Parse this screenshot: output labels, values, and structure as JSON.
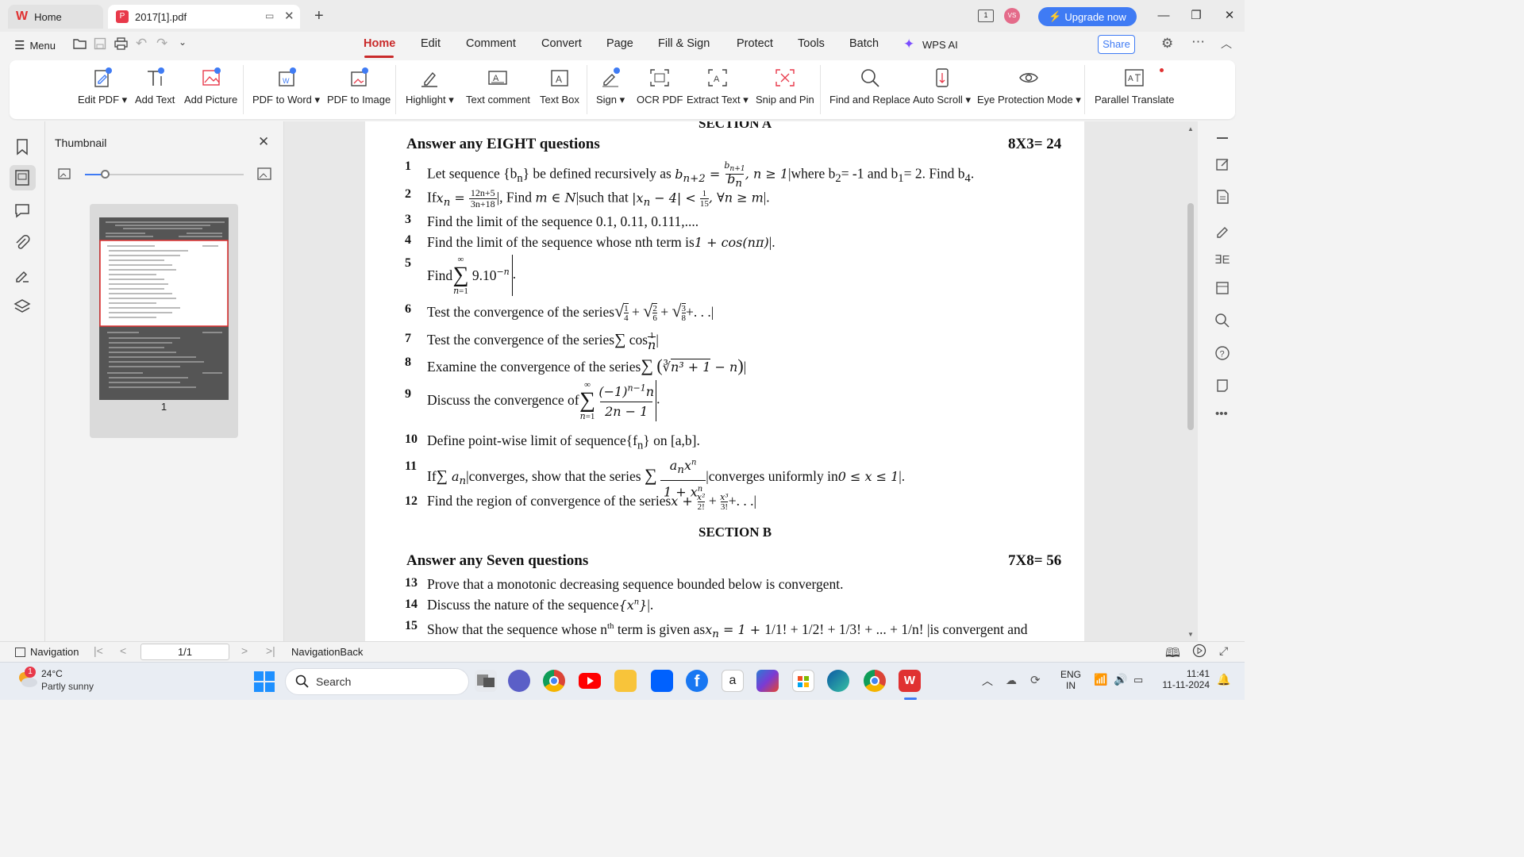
{
  "titlebar": {
    "tabs": [
      {
        "label": "Home"
      },
      {
        "label": "2017[1].pdf"
      }
    ],
    "upgrade_label": "Upgrade now",
    "avatar_initials": "VS",
    "page_count_badge": "1"
  },
  "menubar": {
    "menu_label": "Menu",
    "tabs": [
      "Home",
      "Edit",
      "Comment",
      "Convert",
      "Page",
      "Fill & Sign",
      "Protect",
      "Tools",
      "Batch",
      "WPS AI"
    ],
    "active_tab": "Home",
    "share_label": "Share"
  },
  "ribbon": {
    "items": [
      {
        "label": "Edit PDF",
        "icon": "edit-pdf-icon"
      },
      {
        "label": "Add Text",
        "icon": "add-text-icon"
      },
      {
        "label": "Add Picture",
        "icon": "add-picture-icon"
      },
      {
        "label": "PDF to Word",
        "icon": "pdf-to-word-icon"
      },
      {
        "label": "PDF to Image",
        "icon": "pdf-to-image-icon"
      },
      {
        "label": "Highlight",
        "icon": "highlight-icon"
      },
      {
        "label": "Text comment",
        "icon": "text-comment-icon"
      },
      {
        "label": "Text Box",
        "icon": "text-box-icon"
      },
      {
        "label": "Sign",
        "icon": "sign-icon"
      },
      {
        "label": "OCR PDF",
        "icon": "ocr-icon"
      },
      {
        "label": "Extract Text",
        "icon": "extract-text-icon"
      },
      {
        "label": "Snip and Pin",
        "icon": "snip-icon"
      },
      {
        "label": "Find and Replace",
        "icon": "find-replace-icon"
      },
      {
        "label": "Auto Scroll",
        "icon": "auto-scroll-icon"
      },
      {
        "label": "Eye Protection Mode",
        "icon": "eye-icon"
      },
      {
        "label": "Parallel Translate",
        "icon": "translate-icon"
      }
    ]
  },
  "thumbnail_panel": {
    "title": "Thumbnail",
    "page_number": "1"
  },
  "document": {
    "section_a": "SECTION A",
    "section_a_instruction": "Answer any EIGHT questions",
    "section_a_marks": "8X3= 24",
    "questions_a": [
      {
        "n": "1",
        "text": "Let sequence {bₙ} be defined recursively as bₙ₊₂ = bₙ₊₁/bₙ, n ≥ 1 where b₂= -1 and b₁= 2. Find b₄."
      },
      {
        "n": "2",
        "text": "If xₙ = (12n+5)/(3n+18), Find m ∈ N such that |xₙ − 4| < 1/15, ∀n ≥ m."
      },
      {
        "n": "3",
        "text": "Find the limit of the sequence 0.1, 0.11, 0.111,...."
      },
      {
        "n": "4",
        "text": "Find the limit of the sequence whose nth term is 1 + cos(nπ)."
      },
      {
        "n": "5",
        "text": "Find ∑ 9.10⁻ⁿ (n=1 to ∞)."
      },
      {
        "n": "6",
        "text": "Test the convergence of the series √(1/4) + √(2/6) + √(3/8) + . . ."
      },
      {
        "n": "7",
        "text": "Test the convergence of the series ∑ cos(1/n)"
      },
      {
        "n": "8",
        "text": "Examine the convergence of the series ∑ (∛(n³+1) − n)"
      },
      {
        "n": "9",
        "text": "Discuss the convergence of ∑ (−1)ⁿ⁻¹n / (2n − 1) (n=1 to ∞)."
      },
      {
        "n": "10",
        "text": "Define point-wise limit of sequence {fₙ} on [a,b]."
      },
      {
        "n": "11",
        "text": "If ∑ aₙ converges, show that the series ∑ aₙxⁿ/(1 + xⁿ) converges uniformly in 0 ≤ x ≤ 1."
      },
      {
        "n": "12",
        "text": "Find the region of convergence of the series x + x²/2! + x³/3! + . . ."
      }
    ],
    "section_b": "SECTION B",
    "section_b_instruction": "Answer any Seven questions",
    "section_b_marks": "7X8= 56",
    "questions_b": [
      {
        "n": "13",
        "text": "Prove that a monotonic decreasing sequence bounded below is convergent."
      },
      {
        "n": "14",
        "text": "Discuss the nature of the sequence {xⁿ}."
      },
      {
        "n": "15",
        "text": "Show that the sequence whose nᵗʰ term is given as xₙ = 1 + 1/1! + 1/2! + 1/3! + ... + 1/n! is convergent and"
      }
    ]
  },
  "statusbar": {
    "navigation_label": "Navigation",
    "page_indicator": "1/1",
    "navigation_back_label": "NavigationBack"
  },
  "taskbar": {
    "weather_temp": "24°C",
    "weather_desc": "Partly sunny",
    "weather_badge": "1",
    "search_label": "Search",
    "lang_line1": "ENG",
    "lang_line2": "IN",
    "time": "11:41",
    "date": "11-11-2024"
  },
  "colors": {
    "accent_red": "#c92a2a",
    "upgrade_blue": "#3f7bf4",
    "wps_red": "#e03131"
  }
}
